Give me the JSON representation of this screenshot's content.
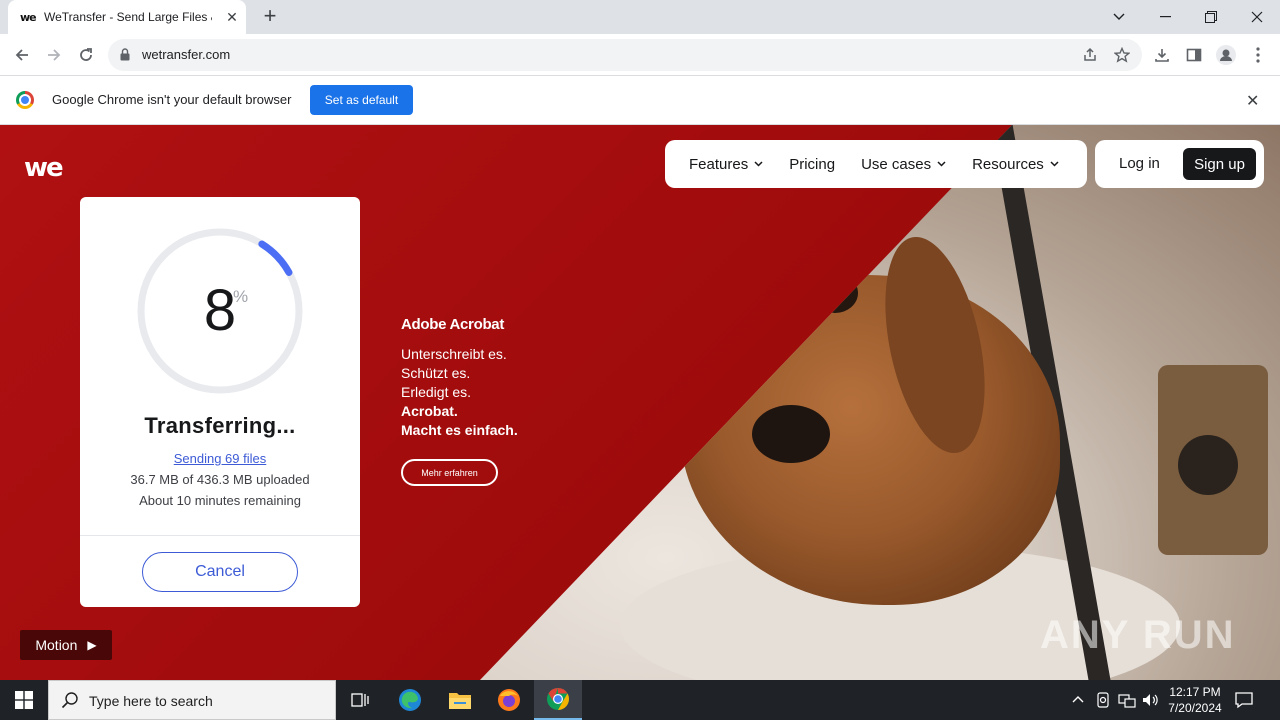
{
  "browser": {
    "tab_title": "WeTransfer - Send Large Files &",
    "tab_favicon": "we",
    "url": "wetransfer.com"
  },
  "infobar": {
    "message": "Google Chrome isn't your default browser",
    "button_label": "Set as default"
  },
  "site": {
    "logo": "we",
    "nav": [
      {
        "label": "Features",
        "has_dropdown": true
      },
      {
        "label": "Pricing",
        "has_dropdown": false
      },
      {
        "label": "Use cases",
        "has_dropdown": true
      },
      {
        "label": "Resources",
        "has_dropdown": true
      }
    ],
    "login_label": "Log in",
    "signup_label": "Sign up"
  },
  "transfer": {
    "percent": "8",
    "percent_sign": "%",
    "progress_fraction": 0.08,
    "status": "Transferring...",
    "sending": "Sending 69 files",
    "uploaded": "36.7 MB of 436.3 MB uploaded",
    "remaining": "About 10 minutes remaining",
    "cancel_label": "Cancel",
    "accent_color": "#3d5bd6"
  },
  "ad": {
    "brand": "Adobe Acrobat",
    "lines": [
      "Unterschreibt es.",
      "Schützt es.",
      "Erledigt es."
    ],
    "bold_lines": [
      "Acrobat.",
      "Macht es einfach."
    ],
    "button_label": "Mehr erfahren"
  },
  "motion_label": "Motion",
  "watermark": "ANY RUN",
  "taskbar": {
    "search_placeholder": "Type here to search",
    "time": "12:17 PM",
    "date": "7/20/2024"
  },
  "colors": {
    "brand_red": "#a40e0e",
    "chrome_blue": "#1a73e8"
  }
}
